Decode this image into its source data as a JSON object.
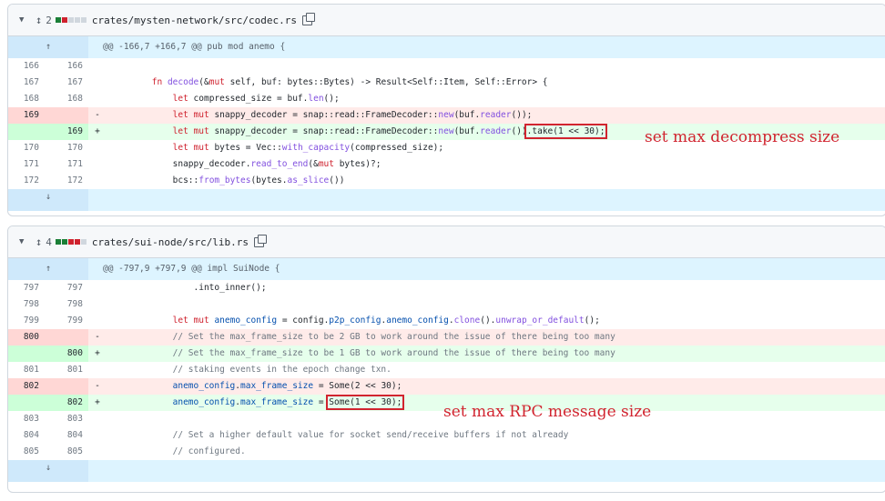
{
  "files": [
    {
      "changes": "2",
      "bars": [
        "#1a7f37",
        "#cf222e",
        "#d0d7de",
        "#d0d7de",
        "#d0d7de"
      ],
      "path": "crates/mysten-network/src/codec.rs",
      "hunk": "@@ -166,7 +166,7 @@ pub mod anemo {",
      "lines": [
        {
          "type": "ctx",
          "old": "166",
          "new": "166",
          "sign": "",
          "indent": "",
          "code": ""
        },
        {
          "type": "ctx",
          "old": "167",
          "new": "167",
          "sign": "",
          "indent": "        ",
          "code": "fn decode(&mut self, buf: bytes::Bytes) -> Result<Self::Item, Self::Error> {"
        },
        {
          "type": "ctx",
          "old": "168",
          "new": "168",
          "sign": "",
          "indent": "            ",
          "code": "let compressed_size = buf.len();"
        },
        {
          "type": "del",
          "old": "169",
          "new": "",
          "sign": "-",
          "indent": "            ",
          "code": "let mut snappy_decoder = snap::read::FrameDecoder::new(buf.reader());"
        },
        {
          "type": "add",
          "old": "",
          "new": "169",
          "sign": "+",
          "indent": "            ",
          "code": "let mut snappy_decoder = snap::read::FrameDecoder::new(buf.reader())",
          "code_boxed": ".take(1 << 30);"
        },
        {
          "type": "ctx",
          "old": "170",
          "new": "170",
          "sign": "",
          "indent": "            ",
          "code": "let mut bytes = Vec::with_capacity(compressed_size);"
        },
        {
          "type": "ctx",
          "old": "171",
          "new": "171",
          "sign": "",
          "indent": "            ",
          "code": "snappy_decoder.read_to_end(&mut bytes)?;"
        },
        {
          "type": "ctx",
          "old": "172",
          "new": "172",
          "sign": "",
          "indent": "            ",
          "code": "bcs::from_bytes(bytes.as_slice())"
        }
      ]
    },
    {
      "changes": "4",
      "bars": [
        "#1a7f37",
        "#1a7f37",
        "#cf222e",
        "#cf222e",
        "#d0d7de"
      ],
      "path": "crates/sui-node/src/lib.rs",
      "hunk": "@@ -797,9 +797,9 @@ impl SuiNode {",
      "lines": [
        {
          "type": "ctx",
          "old": "797",
          "new": "797",
          "sign": "",
          "indent": "                ",
          "code": ".into_inner();"
        },
        {
          "type": "ctx",
          "old": "798",
          "new": "798",
          "sign": "",
          "indent": "",
          "code": ""
        },
        {
          "type": "ctx",
          "old": "799",
          "new": "799",
          "sign": "",
          "indent": "            ",
          "code": "let mut anemo_config = config.p2p_config.anemo_config.clone().unwrap_or_default();"
        },
        {
          "type": "del",
          "old": "800",
          "new": "",
          "sign": "-",
          "indent": "            ",
          "code": "// Set the max_frame_size to be 2 GB to work around the issue of there being too many"
        },
        {
          "type": "add",
          "old": "",
          "new": "800",
          "sign": "+",
          "indent": "            ",
          "code": "// Set the max_frame_size to be 1 GB to work around the issue of there being too many"
        },
        {
          "type": "ctx",
          "old": "801",
          "new": "801",
          "sign": "",
          "indent": "            ",
          "code": "// staking events in the epoch change txn."
        },
        {
          "type": "del",
          "old": "802",
          "new": "",
          "sign": "-",
          "indent": "            ",
          "code": "anemo_config.max_frame_size = Some(2 << 30);"
        },
        {
          "type": "add",
          "old": "",
          "new": "802",
          "sign": "+",
          "indent": "            ",
          "code": "anemo_config.max_frame_size = ",
          "code_boxed": "Some(1 << 30);"
        },
        {
          "type": "ctx",
          "old": "803",
          "new": "803",
          "sign": "",
          "indent": "",
          "code": ""
        },
        {
          "type": "ctx",
          "old": "804",
          "new": "804",
          "sign": "",
          "indent": "            ",
          "code": "// Set a higher default value for socket send/receive buffers if not already"
        },
        {
          "type": "ctx",
          "old": "805",
          "new": "805",
          "sign": "",
          "indent": "            ",
          "code": "// configured."
        }
      ]
    }
  ],
  "annotations": [
    {
      "text": "set max decompress size"
    },
    {
      "text": "set max RPC message size"
    }
  ],
  "icons": {
    "expand_up": "▲",
    "expand_down": "▼",
    "chevron": "chevron-down-icon",
    "unfold": "unfold-icon",
    "copy": "copy-icon"
  }
}
